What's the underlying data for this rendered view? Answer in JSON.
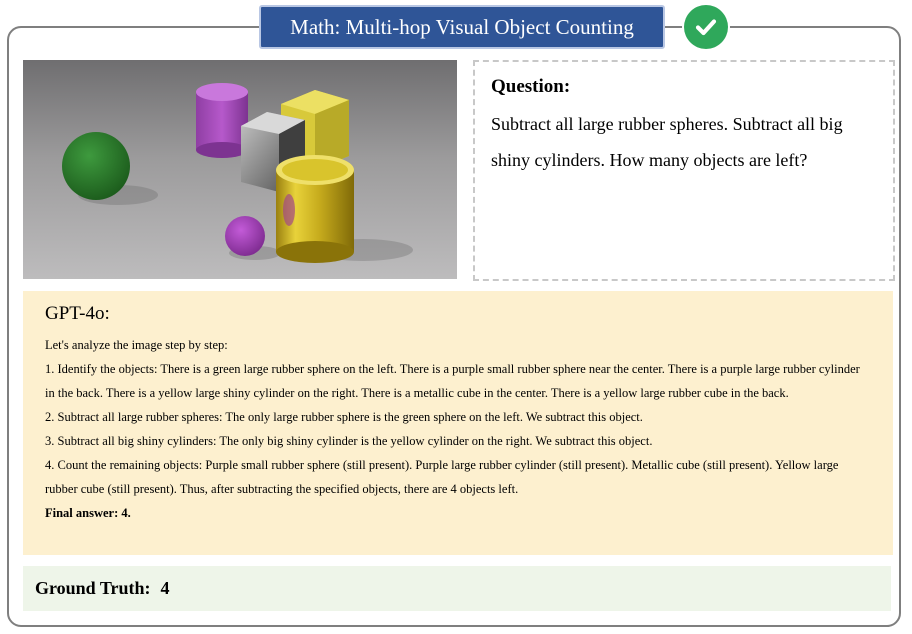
{
  "header": {
    "title": "Math: Multi-hop Visual Object Counting",
    "status_icon": "check-circle-icon",
    "status_color": "#2fa85b"
  },
  "image": {
    "description_icon": "rendered-3d-scene-image"
  },
  "question": {
    "label": "Question:",
    "text": "Subtract all large rubber spheres. Subtract all big shiny cylinders. How many objects are left?"
  },
  "answer": {
    "label": "GPT-4o:",
    "lines": [
      "Let's analyze the image step by step:",
      "1. Identify the objects: There is a green large rubber sphere on the left. There is a purple small rubber sphere near the center. There is a purple large rubber cylinder in the back. There is a yellow large shiny cylinder on the right. There is a metallic cube in the center. There is a yellow large rubber cube in the back.",
      "2. Subtract all large rubber spheres: The only large rubber sphere is the green sphere on the left. We subtract this object.",
      "3. Subtract all big shiny cylinders: The only big shiny cylinder is the yellow cylinder on the right. We subtract this object.",
      "4. Count the remaining objects: Purple small rubber sphere (still present). Purple large rubber cylinder (still present). Metallic cube (still present). Yellow large rubber cube (still present). Thus, after subtracting the specified objects, there are 4 objects left."
    ],
    "final": "Final answer: 4."
  },
  "ground_truth": {
    "label": "Ground Truth:",
    "value": "4"
  },
  "colors": {
    "title_bg": "#2f5597",
    "answer_bg": "#fdf0cf",
    "ground_truth_bg": "#eef5e9"
  }
}
